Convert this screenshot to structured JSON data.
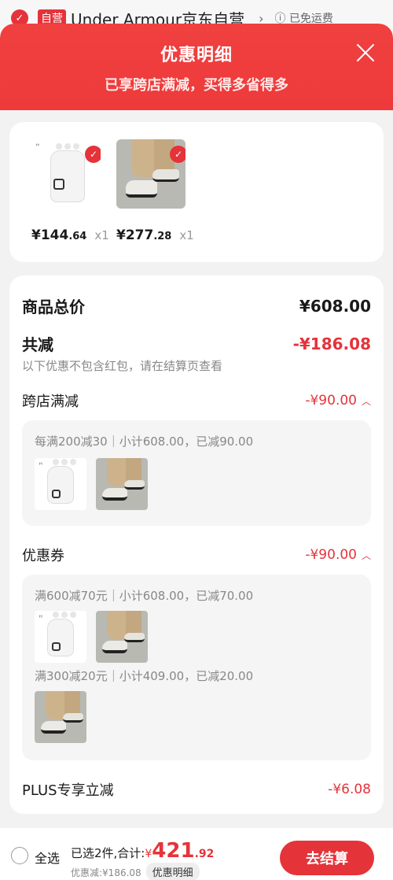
{
  "store": {
    "tag": "自营",
    "name": "Under Armour京东自营",
    "shipping": "已免运费"
  },
  "sheet": {
    "title": "优惠明细",
    "subtitle": "已享跨店满减，买得多省得多"
  },
  "products": [
    {
      "name": "glove",
      "price_int": "¥144",
      "price_dec": ".64",
      "qty": "x1"
    },
    {
      "name": "shoe",
      "price_int": "¥277",
      "price_dec": ".28",
      "qty": "x1"
    }
  ],
  "summary": {
    "total_label": "商品总价",
    "total_value": "¥608.00",
    "discount_label": "共减",
    "discount_value": "-¥186.08",
    "note": "以下优惠不包含红包，请在结算页查看"
  },
  "sections": {
    "cross_store": {
      "label": "跨店满减",
      "value": "-¥90.00",
      "rule": "每满200减30｜小计608.00，已减90.00"
    },
    "coupon": {
      "label": "优惠券",
      "value": "-¥90.00",
      "rule1": "满600减70元｜小计608.00，已减70.00",
      "rule2": "满300减20元｜小计409.00，已减20.00"
    },
    "plus": {
      "label": "PLUS专享立减",
      "value": "-¥6.08"
    }
  },
  "footer": {
    "select_all": "全选",
    "selected_text": "已选2件,合计:",
    "currency": "¥",
    "total_int": "421",
    "total_dec": ".92",
    "discount_text": "优惠减:¥186.08",
    "detail_label": "优惠明细",
    "checkout_label": "去结算"
  },
  "colors": {
    "accent": "#e5333a",
    "header_bg": "#ee3a3a"
  }
}
